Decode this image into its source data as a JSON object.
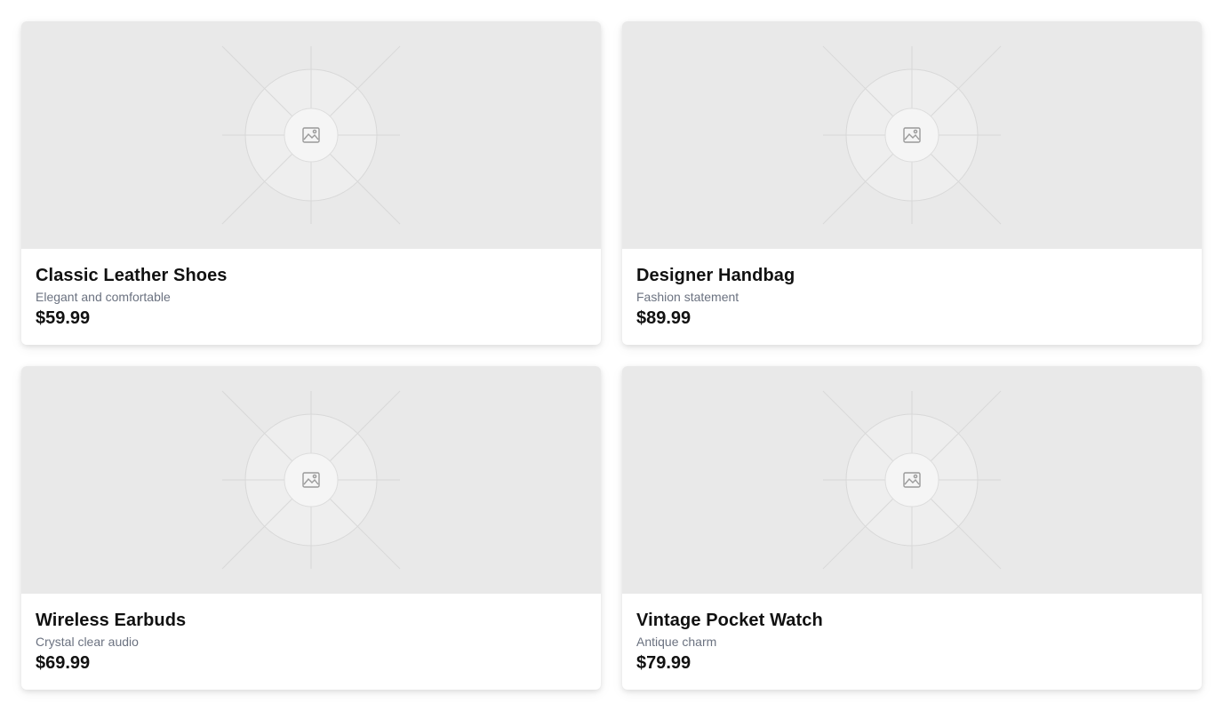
{
  "products": [
    {
      "title": "Classic Leather Shoes",
      "description": "Elegant and comfortable",
      "price": "$59.99",
      "icon": "image-placeholder-icon"
    },
    {
      "title": "Designer Handbag",
      "description": "Fashion statement",
      "price": "$89.99",
      "icon": "image-placeholder-icon"
    },
    {
      "title": "Wireless Earbuds",
      "description": "Crystal clear audio",
      "price": "$69.99",
      "icon": "image-placeholder-icon"
    },
    {
      "title": "Vintage Pocket Watch",
      "description": "Antique charm",
      "price": "$79.99",
      "icon": "image-placeholder-icon"
    }
  ],
  "colors": {
    "image_bg": "#e9e9e9",
    "title": "#111111",
    "description": "#6b7280"
  }
}
